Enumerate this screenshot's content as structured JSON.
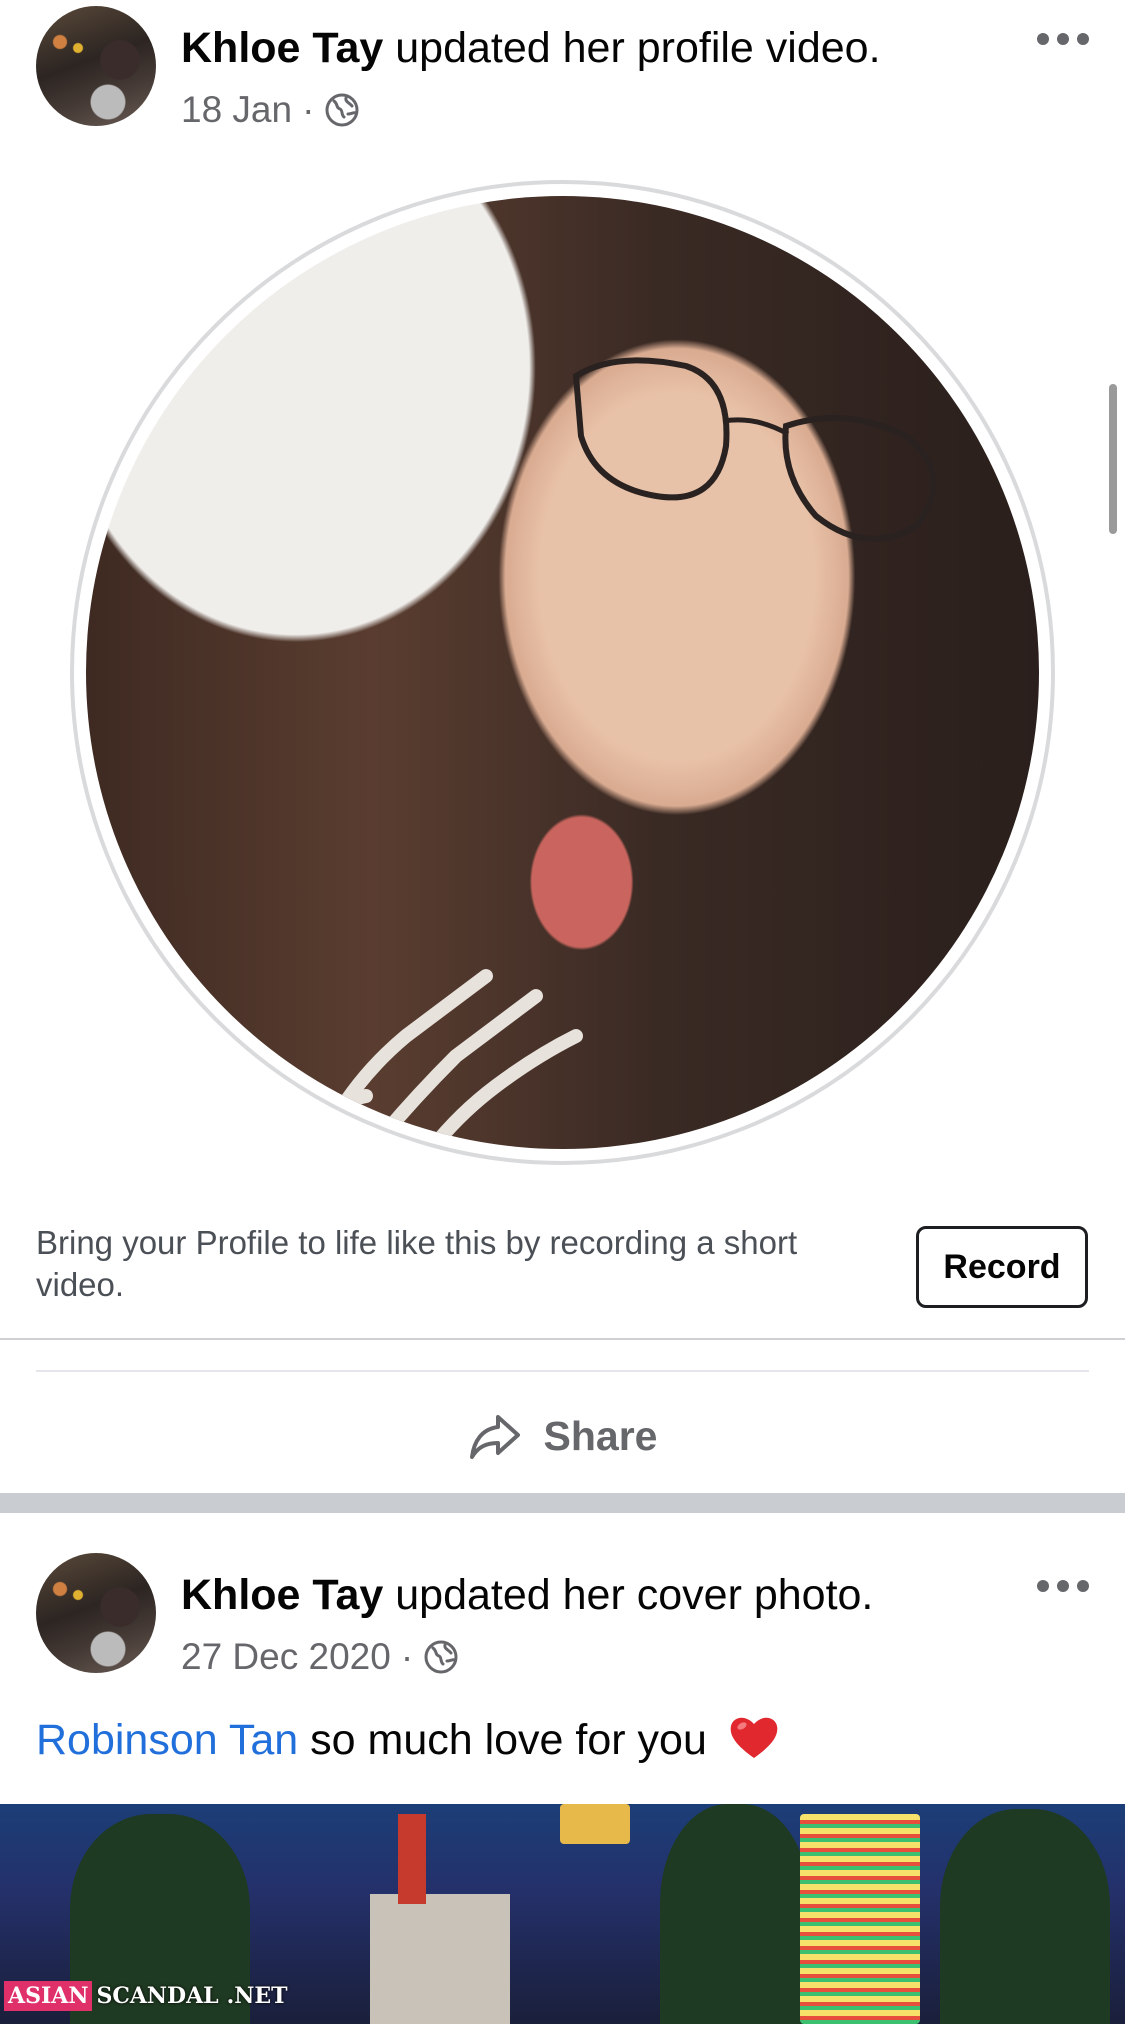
{
  "posts": [
    {
      "author": "Khloe Tay",
      "action": " updated her profile video.",
      "date": "18 Jan",
      "separator": "·",
      "privacy_icon": "globe-icon",
      "more_icon": "more-horizontal-icon",
      "prompt_text": "Bring your Profile to life like this by recording a short video.",
      "record_label": "Record",
      "share_label": "Share",
      "share_icon": "share-arrow-icon"
    },
    {
      "author": "Khloe Tay",
      "action": " updated her cover photo.",
      "date": "27 Dec 2020",
      "separator": "·",
      "privacy_icon": "globe-icon",
      "more_icon": "more-horizontal-icon",
      "caption_mention": "Robinson Tan",
      "caption_text": " so much love for you ",
      "caption_emoji": "heart-emoji"
    }
  ],
  "watermark": {
    "part1": "ASIAN",
    "part2": "SCANDAL",
    "part3": ".NET"
  },
  "colors": {
    "link": "#216fdb",
    "secondary_text": "#65676b",
    "separator": "#c9ccd1",
    "heart": "#e0282e"
  }
}
